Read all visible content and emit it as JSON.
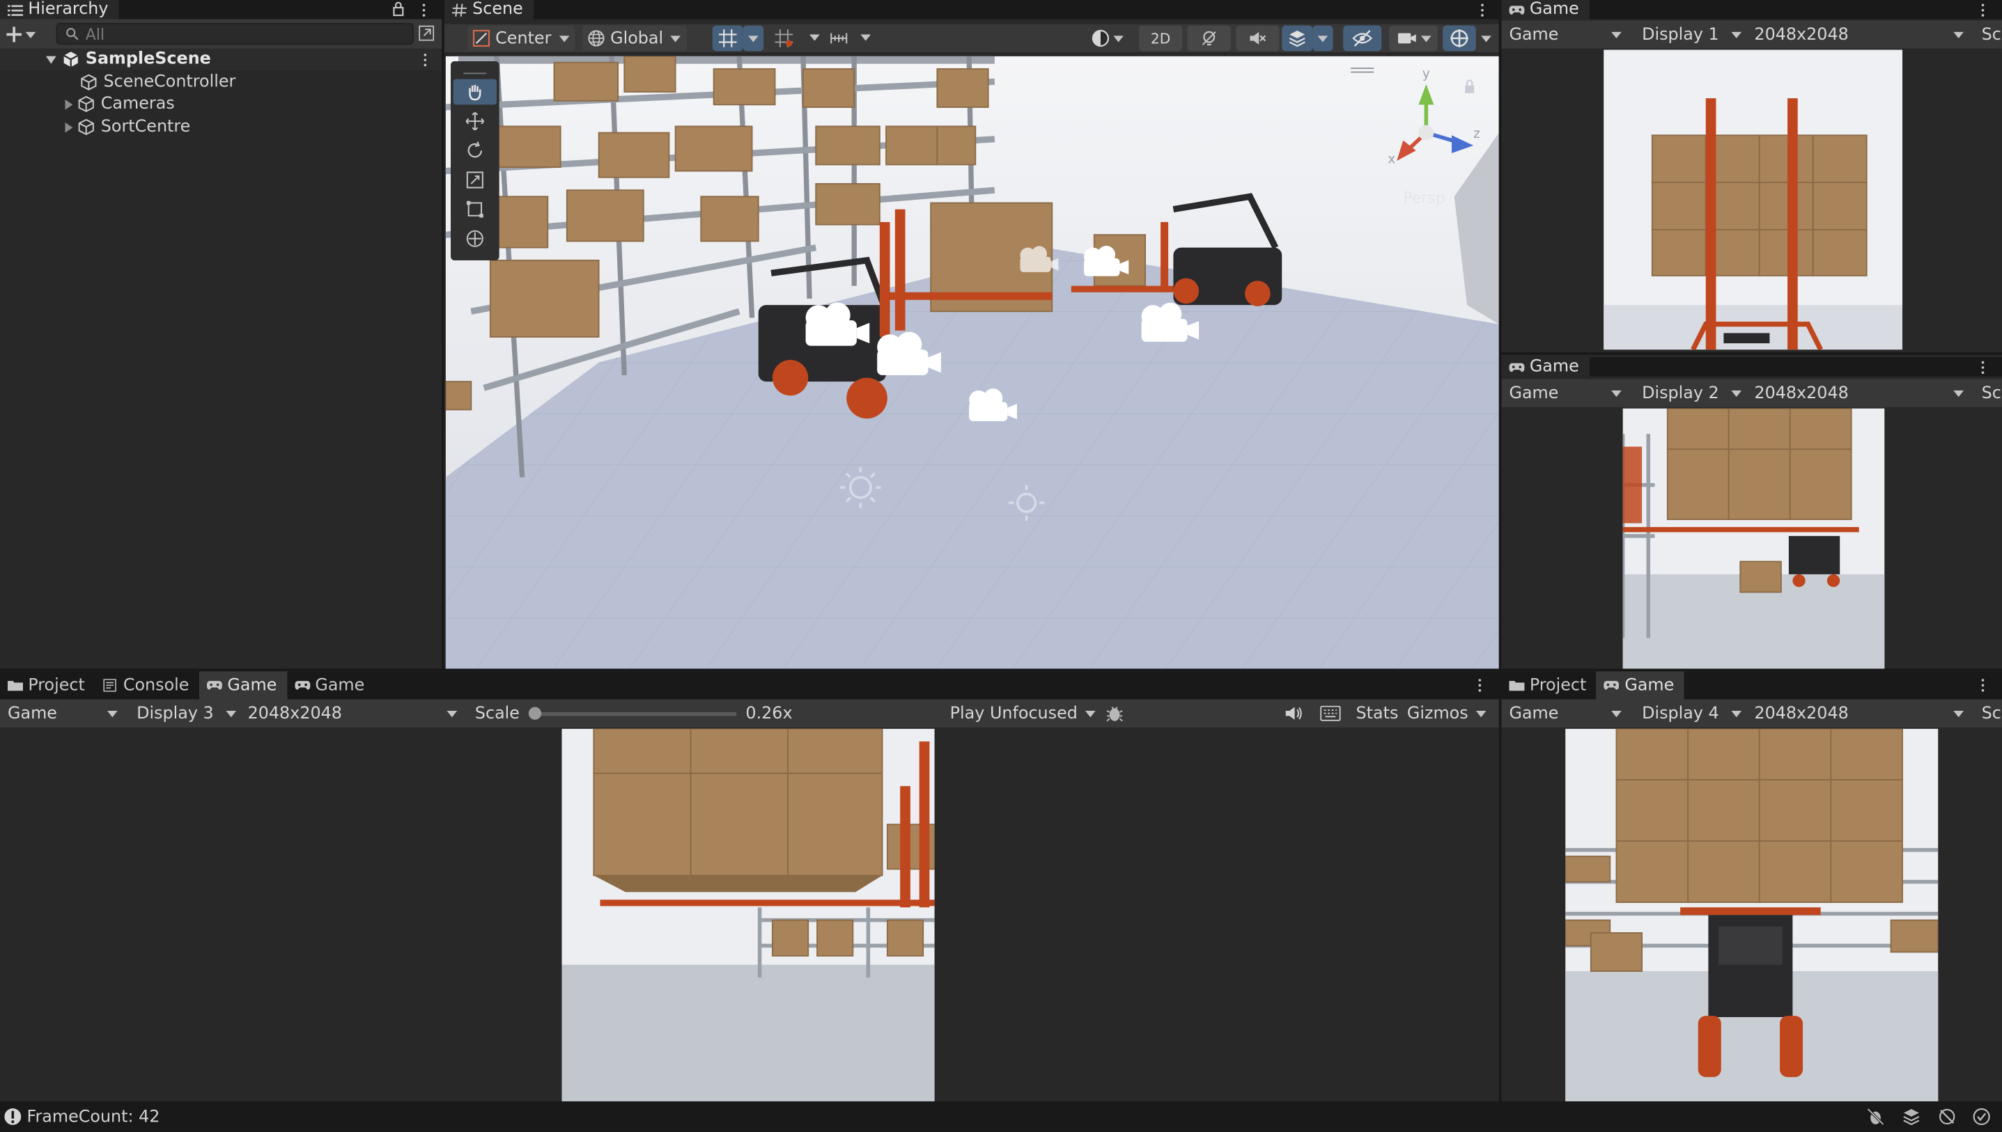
{
  "hierarchy": {
    "tab_label": "Hierarchy",
    "search_placeholder": "All",
    "scene_name": "SampleScene",
    "items": [
      {
        "label": "SceneController",
        "expandable": false
      },
      {
        "label": "Cameras",
        "expandable": true
      },
      {
        "label": "SortCentre",
        "expandable": true
      }
    ]
  },
  "scene": {
    "tab_label": "Scene",
    "pivot_label": "Center",
    "space_label": "Global",
    "mode_2d_label": "2D",
    "persp_label": "Persp",
    "gizmo_axes": {
      "x": "x",
      "y": "y",
      "z": "z"
    }
  },
  "game_top": {
    "tab_label": "Game",
    "view_label": "Game",
    "display_label": "Display 1",
    "resolution_label": "2048x2048",
    "scale_label_partial": "Sc"
  },
  "game_mid": {
    "tab_label": "Game",
    "view_label": "Game",
    "display_label": "Display 2",
    "resolution_label": "2048x2048",
    "scale_label_partial": "Sc"
  },
  "bottom_left": {
    "tabs": [
      {
        "label": "Project",
        "icon": "folder-icon",
        "active": false
      },
      {
        "label": "Console",
        "icon": "console-icon",
        "active": false
      },
      {
        "label": "Game",
        "icon": "gamepad-icon",
        "active": true
      },
      {
        "label": "Game",
        "icon": "gamepad-icon",
        "active": false
      }
    ],
    "view_label": "Game",
    "display_label": "Display 3",
    "resolution_label": "2048x2048",
    "scale_label": "Scale",
    "scale_value_text": "0.26x",
    "scale_fraction": 0.0,
    "play_mode_label": "Play Unfocused",
    "stats_label": "Stats",
    "gizmos_label": "Gizmos"
  },
  "bottom_right": {
    "tabs": [
      {
        "label": "Project",
        "icon": "folder-icon",
        "active": false
      },
      {
        "label": "Game",
        "icon": "gamepad-icon",
        "active": true
      }
    ],
    "view_label": "Game",
    "display_label": "Display 4",
    "resolution_label": "2048x2048",
    "scale_label_partial": "Sc"
  },
  "status_bar": {
    "message": "FrameCount: 42"
  },
  "colors": {
    "box": "#a9835a",
    "box_dark": "#8b6a46",
    "forklift_orange": "#c0461e",
    "forklift_body": "#2a2a2c",
    "floor": "#b7bed2",
    "wall": "#e6e8ec",
    "accent_button": "#46607c"
  }
}
